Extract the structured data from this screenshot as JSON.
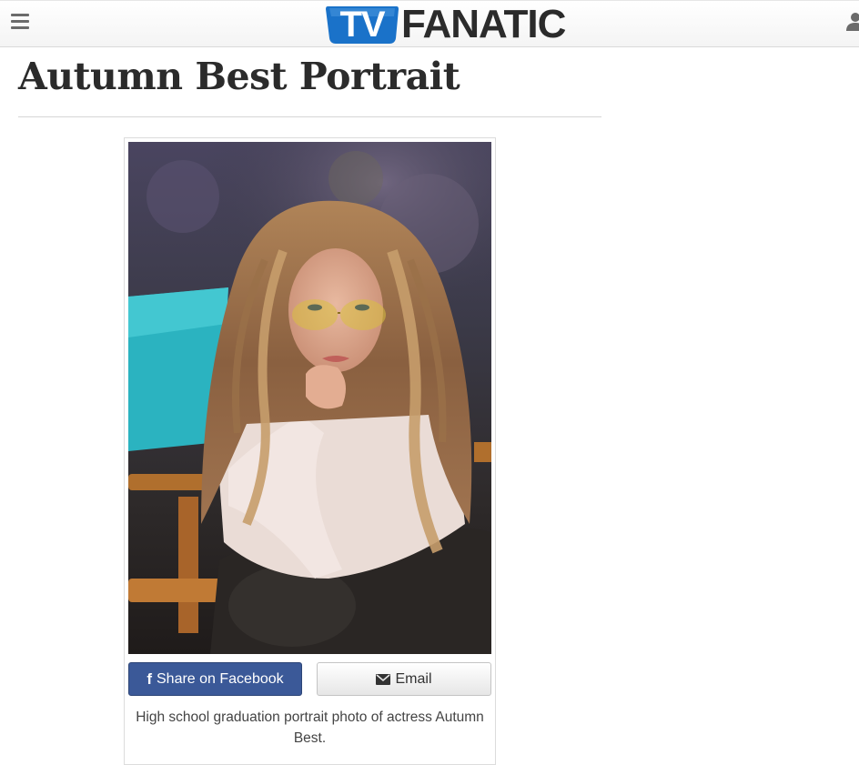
{
  "header": {
    "logo_tv": "TV",
    "logo_fanatic": "FANATIC"
  },
  "article": {
    "title": "Autumn Best Portrait",
    "photo_alt": "Portrait of Autumn Best",
    "caption": "High school graduation portrait photo of actress Autumn Best."
  },
  "share": {
    "facebook_label": "Share on Facebook",
    "email_label": "Email"
  },
  "icons": {
    "menu": "hamburger-menu-icon",
    "user": "user-icon",
    "facebook": "facebook-icon",
    "email": "envelope-icon"
  },
  "colors": {
    "facebook_blue": "#3b5998",
    "logo_blue": "#1a72c9",
    "title_text": "#2b2b2b"
  }
}
